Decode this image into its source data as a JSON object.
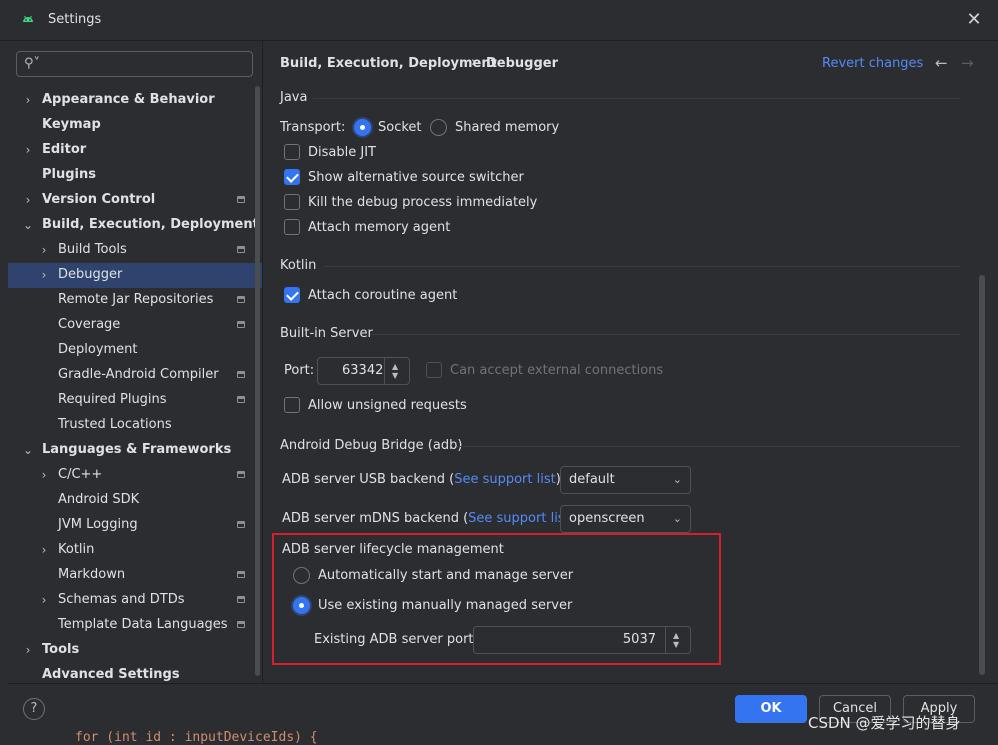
{
  "window": {
    "title": "Settings"
  },
  "search": {
    "placeholder": ""
  },
  "sidebar": {
    "items": [
      {
        "label": "Appearance & Behavior",
        "bold": true,
        "arrow": "›",
        "indent": 0
      },
      {
        "label": "Keymap",
        "bold": true,
        "arrow": "",
        "indent": 0
      },
      {
        "label": "Editor",
        "bold": true,
        "arrow": "›",
        "indent": 0
      },
      {
        "label": "Plugins",
        "bold": true,
        "arrow": "",
        "indent": 0
      },
      {
        "label": "Version Control",
        "bold": true,
        "arrow": "›",
        "indent": 0,
        "project": true
      },
      {
        "label": "Build, Execution, Deployment",
        "bold": true,
        "arrow": "⌄",
        "indent": 0
      },
      {
        "label": "Build Tools",
        "bold": false,
        "arrow": "›",
        "indent": 1,
        "project": true
      },
      {
        "label": "Debugger",
        "bold": false,
        "arrow": "›",
        "indent": 1,
        "selected": true
      },
      {
        "label": "Remote Jar Repositories",
        "bold": false,
        "arrow": "",
        "indent": 1,
        "project": true
      },
      {
        "label": "Coverage",
        "bold": false,
        "arrow": "",
        "indent": 1,
        "project": true
      },
      {
        "label": "Deployment",
        "bold": false,
        "arrow": "",
        "indent": 1
      },
      {
        "label": "Gradle-Android Compiler",
        "bold": false,
        "arrow": "",
        "indent": 1,
        "project": true
      },
      {
        "label": "Required Plugins",
        "bold": false,
        "arrow": "",
        "indent": 1,
        "project": true
      },
      {
        "label": "Trusted Locations",
        "bold": false,
        "arrow": "",
        "indent": 1
      },
      {
        "label": "Languages & Frameworks",
        "bold": true,
        "arrow": "⌄",
        "indent": 0
      },
      {
        "label": "C/C++",
        "bold": false,
        "arrow": "›",
        "indent": 1,
        "project": true
      },
      {
        "label": "Android SDK",
        "bold": false,
        "arrow": "",
        "indent": 1
      },
      {
        "label": "JVM Logging",
        "bold": false,
        "arrow": "",
        "indent": 1,
        "project": true
      },
      {
        "label": "Kotlin",
        "bold": false,
        "arrow": "›",
        "indent": 1
      },
      {
        "label": "Markdown",
        "bold": false,
        "arrow": "",
        "indent": 1,
        "project": true
      },
      {
        "label": "Schemas and DTDs",
        "bold": false,
        "arrow": "›",
        "indent": 1,
        "project": true
      },
      {
        "label": "Template Data Languages",
        "bold": false,
        "arrow": "",
        "indent": 1,
        "project": true
      },
      {
        "label": "Tools",
        "bold": true,
        "arrow": "›",
        "indent": 0
      },
      {
        "label": "Advanced Settings",
        "bold": true,
        "arrow": "",
        "indent": 0
      }
    ]
  },
  "header": {
    "crumb1": "Build, Execution, Deployment",
    "separator": "›",
    "crumb2": "Debugger",
    "revert": "Revert changes",
    "back": "←",
    "forward": "→"
  },
  "java": {
    "title": "Java",
    "transport_label": "Transport:",
    "socket": "Socket",
    "shared_memory": "Shared memory",
    "disable_jit": "Disable JIT",
    "show_alt_switcher": "Show alternative source switcher",
    "kill_debug": "Kill the debug process immediately",
    "attach_memory": "Attach memory agent"
  },
  "kotlin": {
    "title": "Kotlin",
    "attach_coroutine": "Attach coroutine agent"
  },
  "server": {
    "title": "Built-in Server",
    "port_label": "Port:",
    "port_value": "63342",
    "external": "Can accept external connections",
    "unsigned": "Allow unsigned requests"
  },
  "adb": {
    "title": "Android Debug Bridge (adb)",
    "usb_prefix": "ADB server USB backend (",
    "usb_link": "See support list",
    "usb_suffix": ")",
    "usb_value": "default",
    "mdns_prefix": "ADB server mDNS backend (",
    "mdns_link": "See support list",
    "mdns_suffix": ")",
    "mdns_value": "openscreen",
    "lifecycle_title": "ADB server lifecycle management",
    "auto": "Automatically start and manage server",
    "manual": "Use existing manually managed server",
    "port_label": "Existing ADB server port:",
    "port_value": "5037"
  },
  "footer": {
    "help": "?",
    "ok": "OK",
    "cancel": "Cancel",
    "apply": "Apply"
  },
  "background": {
    "watermark": "CSDN @爱学习的替身",
    "code_line": "for (int id : inputDeviceIds) {"
  },
  "colors": {
    "accent": "#3574f0",
    "selection": "#2e436e",
    "link": "#548af7",
    "highlight_box": "#d3202a"
  }
}
